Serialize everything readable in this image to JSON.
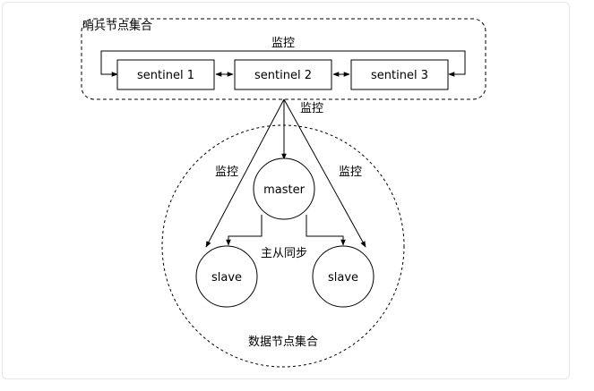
{
  "sentinel_group": {
    "title": "哨兵节点集合",
    "monitor_label": "监控",
    "nodes": [
      {
        "label": "sentinel 1"
      },
      {
        "label": "sentinel 2"
      },
      {
        "label": "sentinel 3"
      }
    ]
  },
  "monitor_label_top": "监控",
  "monitor_label_left": "监控",
  "monitor_label_right": "监控",
  "data_group": {
    "title": "数据节点集合",
    "master_label": "master",
    "slave_left_label": "slave",
    "slave_right_label": "slave",
    "sync_label": "主从同步"
  }
}
